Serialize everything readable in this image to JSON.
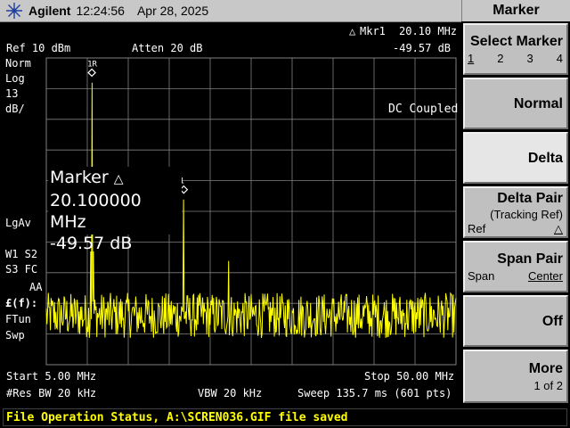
{
  "titlebar": {
    "brand": "Agilent",
    "time": "12:24:56",
    "date": "Apr 28, 2025",
    "logo_icon": "agilent-spark-icon"
  },
  "header": {
    "ref_level": "Ref 10 dBm",
    "atten": "Atten 20 dB",
    "marker_readout_label": "Mkr1",
    "marker_readout_freq": "20.10 MHz",
    "marker_readout_amp": "-49.57 dB",
    "delta_symbol": "△"
  },
  "left_annotations": {
    "norm": "Norm",
    "log": "Log",
    "scale_value": "13",
    "scale_unit": "dB/",
    "lgav": "LgAv",
    "w1s2": "W1  S2",
    "s3fc": "S3  FC",
    "aa": "AA",
    "ftun_f": "£(f):",
    "ftun": "FTun",
    "swp": "Swp"
  },
  "dc_coupled": "DC Coupled",
  "marker_box": {
    "title": "Marker",
    "delta_symbol": "△",
    "freq": "20.100000 MHz",
    "amp": "-49.57 dB"
  },
  "marker_labels": {
    "ref_marker": "1R",
    "delta_marker": "1"
  },
  "footer": {
    "start": "Start 5.00 MHz",
    "stop": "Stop 50.00 MHz",
    "res_bw": "#Res BW 20 kHz",
    "vbw": "VBW 20 kHz",
    "sweep": "Sweep 135.7 ms (601 pts)"
  },
  "softkeys": {
    "menu_title": "Marker",
    "select_marker": {
      "label": "Select Marker",
      "options": [
        "1",
        "2",
        "3",
        "4"
      ]
    },
    "normal": "Normal",
    "delta": "Delta",
    "delta_pair": {
      "label": "Delta Pair",
      "sub": "(Tracking Ref)",
      "left": "Ref",
      "right_symbol": "△"
    },
    "span_pair": {
      "label": "Span Pair",
      "left": "Span",
      "right": "Center"
    },
    "off": "Off",
    "more": {
      "label": "More",
      "sub": "1 of 2"
    }
  },
  "status": {
    "message": "File Operation Status, A:\\SCREN036.GIF file saved"
  },
  "colors": {
    "trace": "#ffff00",
    "graticule": "#808080",
    "status_text": "#ffff00"
  },
  "trace": {
    "start_mhz": 5.0,
    "stop_mhz": 50.0,
    "points": 601,
    "ref_dbm": 10,
    "db_per_div": 13,
    "divisions": 10,
    "noise_floor_db": -102,
    "noise_spread_db": 12,
    "spurs": [
      {
        "freq_mhz": 10.0,
        "amp_db": -0.5
      },
      {
        "freq_mhz": 20.1,
        "amp_db": -50.0
      },
      {
        "freq_mhz": 25.0,
        "amp_db": -76
      },
      {
        "freq_mhz": 9.9,
        "amp_db": -72
      },
      {
        "freq_mhz": 10.2,
        "amp_db": -72
      }
    ]
  },
  "markers": {
    "ref_freq_mhz": 10.0,
    "ref_amp_db": 0.0,
    "delta_freq_mhz": 20.1,
    "delta_amp_db": -49.57
  }
}
